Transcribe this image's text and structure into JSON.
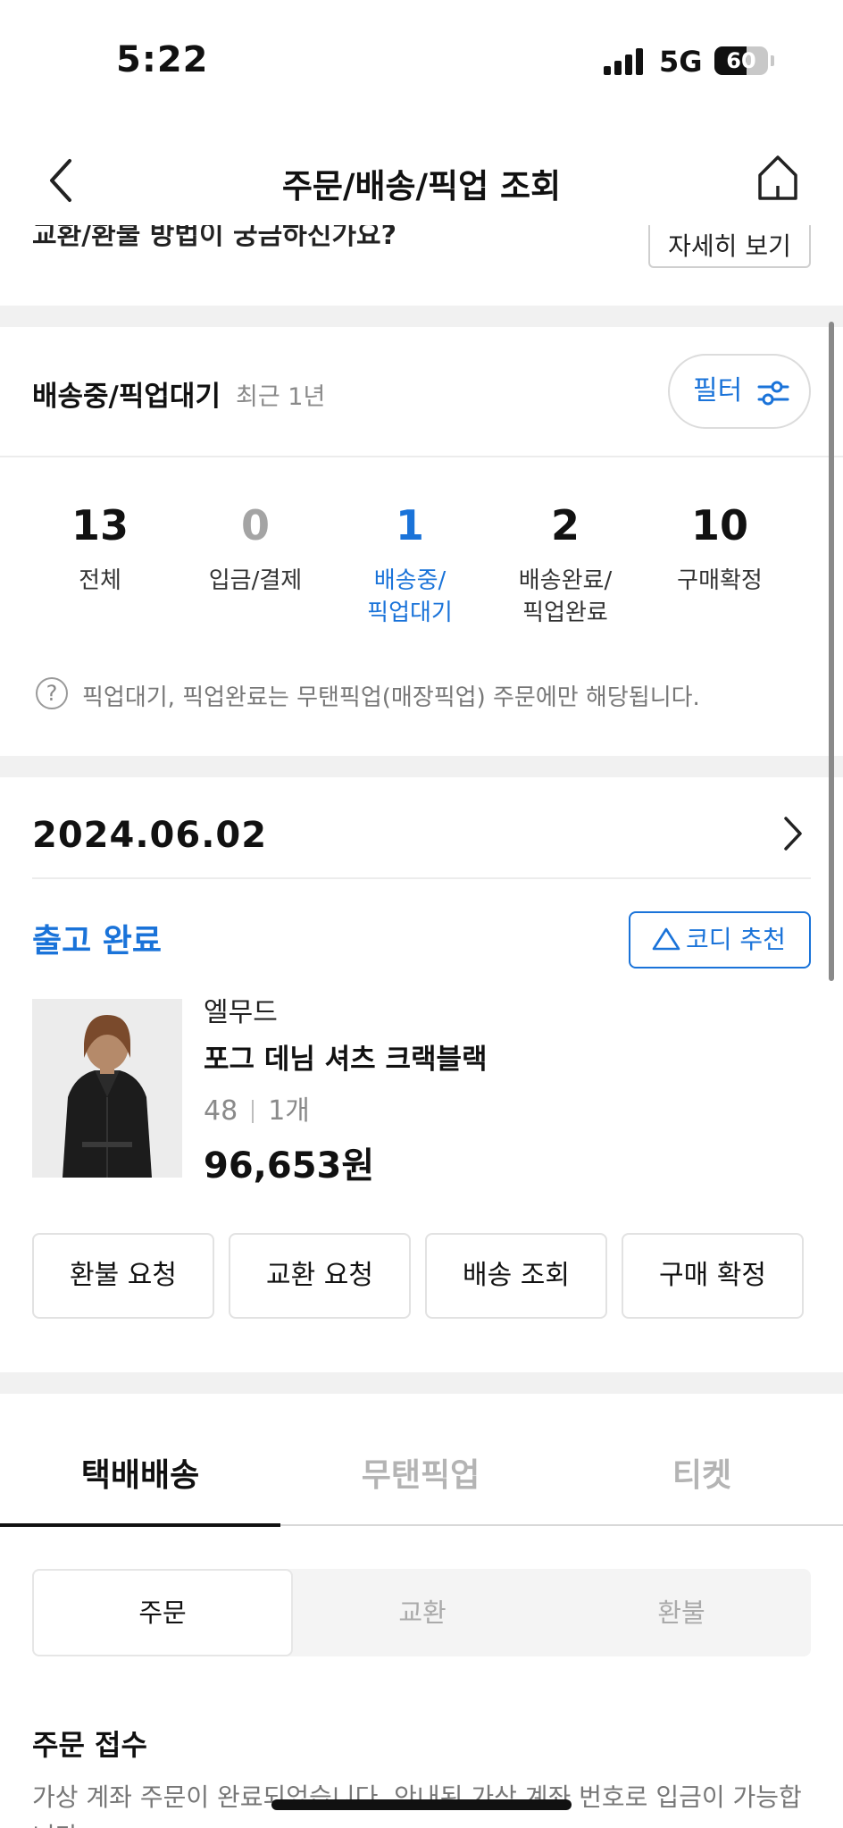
{
  "status_bar": {
    "time": "5:22",
    "network": "5G",
    "battery_percent": "60",
    "battery_level": 0.6,
    "signal_bars": 4
  },
  "header": {
    "title": "주문/배송/픽업 조회",
    "back_icon": "chevron-left-icon",
    "home_icon": "home-icon"
  },
  "banner": {
    "text": "교환/환불 방법이 궁금하신가요?",
    "detail_label": "자세히 보기"
  },
  "summary": {
    "title": "배송중/픽업대기",
    "period": "최근 1년",
    "filter_label": "필터",
    "counts": [
      {
        "value": "13",
        "label": "전체"
      },
      {
        "value": "0",
        "label": "입금/결제"
      },
      {
        "value": "1",
        "label": "배송중/\n픽업대기"
      },
      {
        "value": "2",
        "label": "배송완료/\n픽업완료"
      },
      {
        "value": "10",
        "label": "구매확정"
      }
    ],
    "note_icon": "?",
    "note": "픽업대기, 픽업완료는 무탠픽업(매장픽업) 주문에만 해당됩니다."
  },
  "order": {
    "date": "2024.06.02",
    "status": "출고 완료",
    "codi_label": "코디 추천",
    "brand": "엘무드",
    "product_name": "포그 데님 셔츠 크랙블랙",
    "size": "48",
    "quantity": "1개",
    "price": "96,653원",
    "actions": [
      "환불 요청",
      "교환 요청",
      "배송 조회",
      "구매 확정"
    ]
  },
  "tabs": {
    "items": [
      "택배배송",
      "무탠픽업",
      "티켓"
    ],
    "active": 0
  },
  "segments": {
    "items": [
      "주문",
      "교환",
      "환불"
    ],
    "active": 0
  },
  "info": {
    "title": "주문 접수",
    "desc": "가상 계좌 주문이 완료되었습니다. 안내된 가상 계좌 번호로 입금이 가능합니다."
  },
  "colors": {
    "accent": "#1a73d9",
    "muted": "#a4a4a4",
    "divider_bg": "#f1f1f1"
  }
}
